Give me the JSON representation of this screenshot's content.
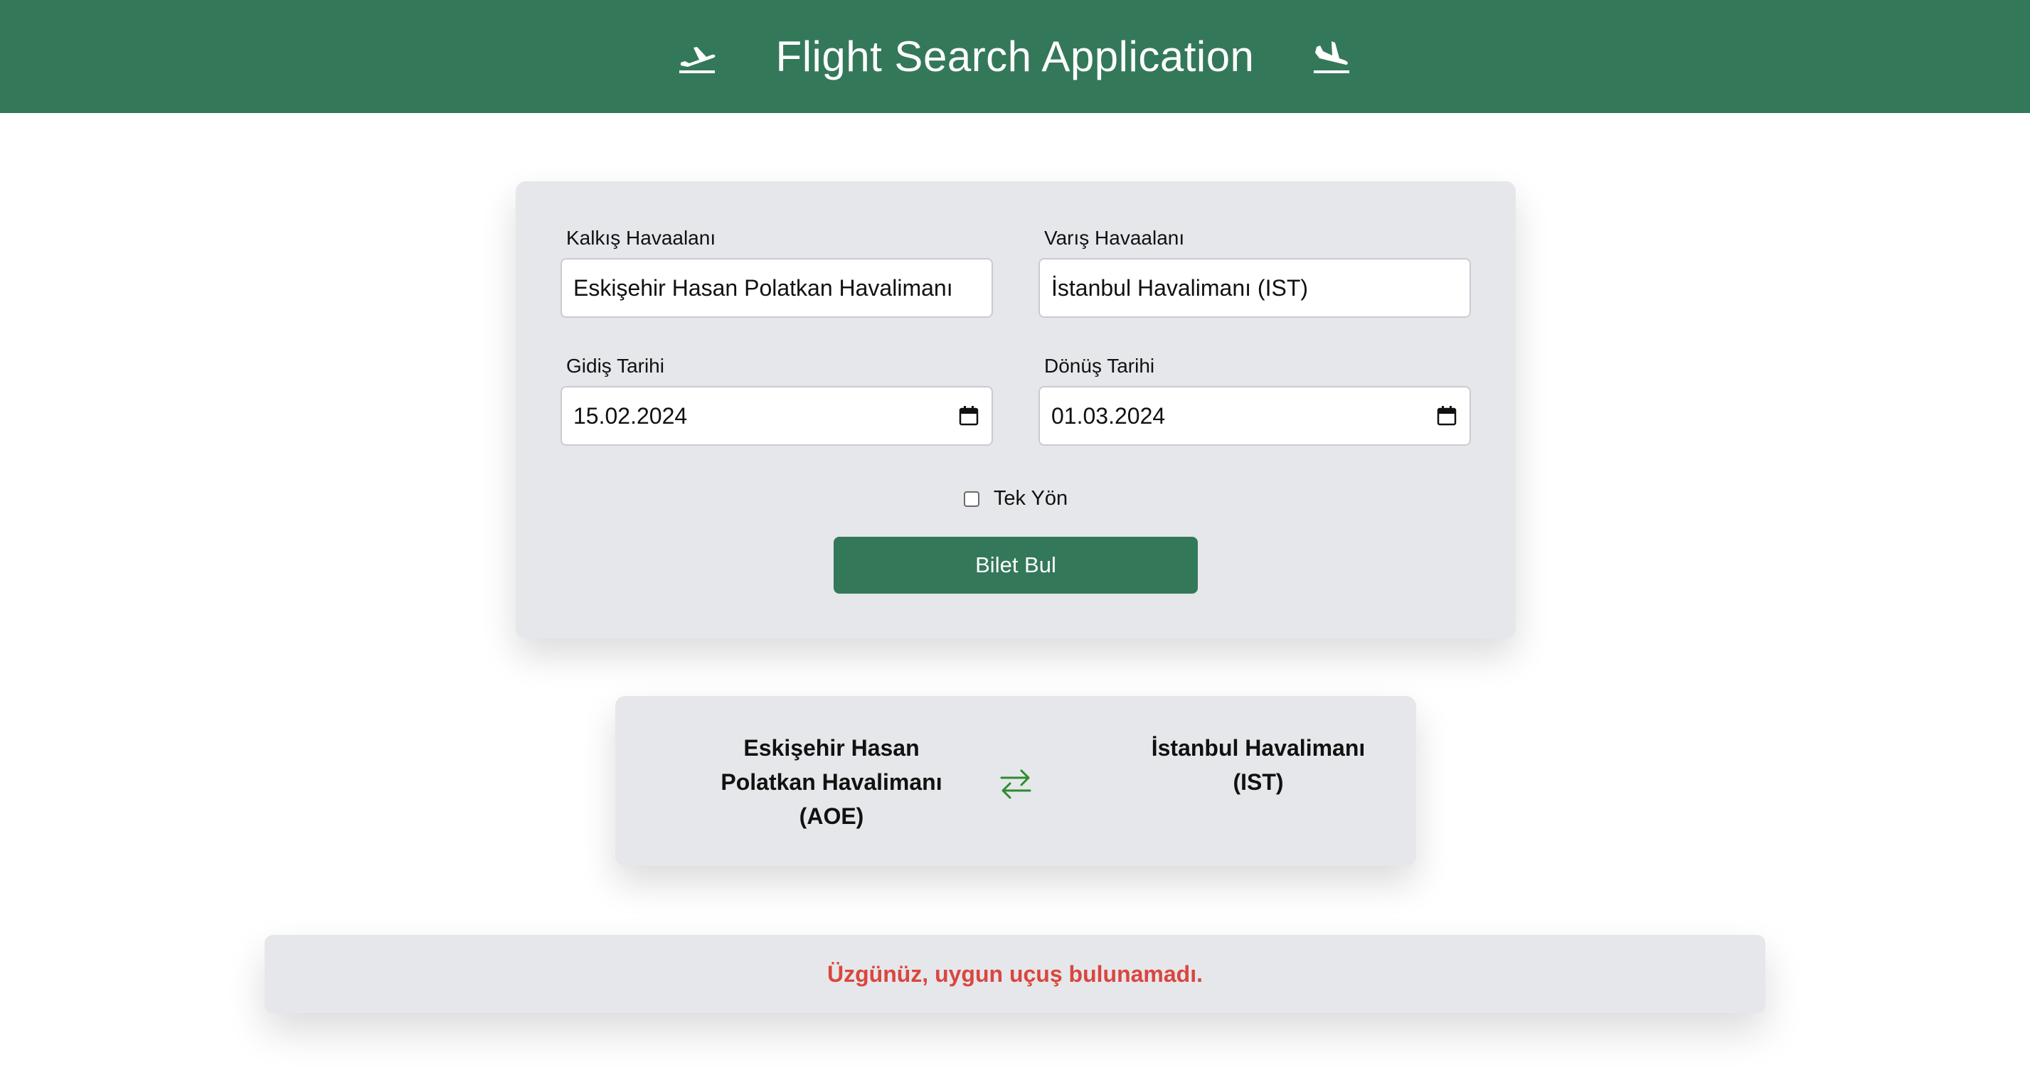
{
  "header": {
    "title": "Flight Search Application",
    "left_icon": "plane-departure-icon",
    "right_icon": "plane-arrival-icon",
    "color": "#34785a"
  },
  "form": {
    "departure_airport": {
      "label": "Kalkış Havaalanı",
      "value": "Eskişehir Hasan Polatkan Havalimanı"
    },
    "arrival_airport": {
      "label": "Varış Havaalanı",
      "value": "İstanbul Havalimanı (IST)"
    },
    "departure_date": {
      "label": "Gidiş Tarihi",
      "value": "15.02.2024",
      "icon": "calendar-icon"
    },
    "return_date": {
      "label": "Dönüş Tarihi",
      "value": "01.03.2024",
      "icon": "calendar-icon"
    },
    "one_way": {
      "label": "Tek Yön",
      "checked": false
    },
    "search_button": "Bilet Bul"
  },
  "route": {
    "from_line1": "Eskişehir Hasan",
    "from_line2": "Polatkan Havalimanı",
    "from_line3": "(AOE)",
    "to_line1": "İstanbul Havalimanı",
    "to_line2": "(IST)",
    "swap_icon": "swap-arrows-icon",
    "swap_color": "#2e8b2e"
  },
  "message": {
    "text": "Üzgünüz, uygun uçuş bulunamadı.",
    "color": "#d9463f"
  }
}
